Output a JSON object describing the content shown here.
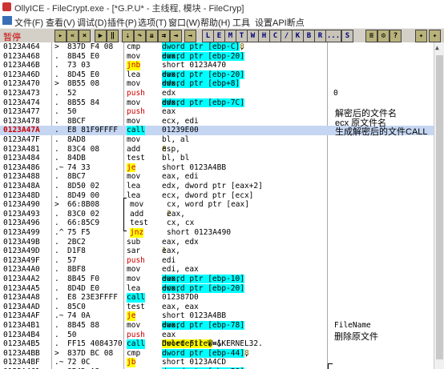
{
  "window": {
    "title": "OllyICE - FileCrypt.exe - [*G.P.U* - 主线程, 模块 - FileCryp]"
  },
  "menu": [
    "文件(F)",
    "查看(V)",
    "调试(D)",
    "插件(P)",
    "选项(T)",
    "窗口(W)",
    "帮助(H)",
    "工具",
    "设置API断点"
  ],
  "toolbar": {
    "status": "暂停",
    "buttons": [
      "L",
      "E",
      "M",
      "T",
      "W",
      "H",
      "C",
      "/",
      "K",
      "B",
      "R",
      "...",
      "S"
    ]
  },
  "rows": [
    {
      "addr": "0123A464",
      "flag": ">",
      "hex": "837D F4 08",
      "mn": "cmp",
      "ops": [
        {
          "t": "dword ptr [ebp-C]",
          "s": "hl"
        },
        {
          "t": ", "
        },
        {
          "t": "8",
          "s": "n"
        }
      ]
    },
    {
      "addr": "0123A468",
      "flag": ".",
      "hex": "8B45 E0",
      "mn": "mov",
      "ops": [
        {
          "t": "eax, "
        },
        {
          "t": "dword ptr [ebp-20]",
          "s": "hl"
        }
      ]
    },
    {
      "addr": "0123A46B",
      "flag": ".",
      "hex": "73 03",
      "mn": "jnb",
      "ms": "y",
      "ops": [
        {
          "t": "short 0123A470"
        }
      ]
    },
    {
      "addr": "0123A46D",
      "flag": ".",
      "hex": "8D45 E0",
      "mn": "lea",
      "ops": [
        {
          "t": "eax, "
        },
        {
          "t": "dword ptr [ebp-20]",
          "s": "hl"
        }
      ]
    },
    {
      "addr": "0123A470",
      "flag": ">",
      "hex": "8B55 08",
      "mn": "mov",
      "ops": [
        {
          "t": "edx, "
        },
        {
          "t": "dword ptr [ebp+8]",
          "s": "hl"
        }
      ]
    },
    {
      "addr": "0123A473",
      "flag": ".",
      "hex": "52",
      "mn": "push",
      "ms": "r",
      "ops": [
        {
          "t": "edx"
        }
      ],
      "cmt": "0"
    },
    {
      "addr": "0123A474",
      "flag": ".",
      "hex": "8B55 84",
      "mn": "mov",
      "ops": [
        {
          "t": "edx, "
        },
        {
          "t": "dword ptr [ebp-7C]",
          "s": "hl"
        }
      ]
    },
    {
      "addr": "0123A477",
      "flag": ".",
      "hex": "50",
      "mn": "push",
      "ms": "r",
      "ops": [
        {
          "t": "eax"
        }
      ]
    },
    {
      "addr": "0123A478",
      "flag": ".",
      "hex": "8BCF",
      "mn": "mov",
      "ops": [
        {
          "t": "ecx, edi"
        }
      ]
    },
    {
      "addr": "0123A47A",
      "flag": ".",
      "hex": "E8 81F9FFFF",
      "mn": "call",
      "ms": "c",
      "ops": [
        {
          "t": "01239E00"
        }
      ],
      "sel": true
    },
    {
      "addr": "0123A47F",
      "flag": ".",
      "hex": "8AD8",
      "mn": "mov",
      "ops": [
        {
          "t": "bl, al"
        }
      ]
    },
    {
      "addr": "0123A481",
      "flag": ".",
      "hex": "83C4 08",
      "mn": "add",
      "ops": [
        {
          "t": "esp, "
        },
        {
          "t": "8",
          "s": "n"
        }
      ]
    },
    {
      "addr": "0123A484",
      "flag": ".",
      "hex": "84DB",
      "mn": "test",
      "ops": [
        {
          "t": "bl, bl"
        }
      ]
    },
    {
      "addr": "0123A486",
      "flag": ".~",
      "hex": "74 33",
      "mn": "je",
      "ms": "y",
      "ops": [
        {
          "t": "short 0123A4BB"
        }
      ]
    },
    {
      "addr": "0123A488",
      "flag": ".",
      "hex": "8BC7",
      "mn": "mov",
      "ops": [
        {
          "t": "eax, edi"
        }
      ]
    },
    {
      "addr": "0123A48A",
      "flag": ".",
      "hex": "8D50 02",
      "mn": "lea",
      "ops": [
        {
          "t": "edx, dword ptr [eax+2]"
        }
      ]
    },
    {
      "addr": "0123A48D",
      "flag": ".",
      "hex": "8D49 00",
      "mn": "lea",
      "ops": [
        {
          "t": "ecx, dword ptr [ecx]"
        }
      ]
    },
    {
      "addr": "0123A490",
      "flag": ">",
      "hex": "66:8B08",
      "mn": "mov",
      "ops": [
        {
          "t": "cx, word ptr [eax]"
        }
      ],
      "ind": true
    },
    {
      "addr": "0123A493",
      "flag": ".",
      "hex": "83C0 02",
      "mn": "add",
      "ops": [
        {
          "t": "eax, "
        },
        {
          "t": "2",
          "s": "n"
        }
      ],
      "ind": true
    },
    {
      "addr": "0123A496",
      "flag": ".",
      "hex": "66:85C9",
      "mn": "test",
      "ops": [
        {
          "t": "cx, cx"
        }
      ],
      "ind": true
    },
    {
      "addr": "0123A499",
      "flag": ".^",
      "hex": "75 F5",
      "mn": "jnz",
      "ms": "y",
      "ops": [
        {
          "t": "short 0123A490"
        }
      ],
      "ind": true
    },
    {
      "addr": "0123A49B",
      "flag": ".",
      "hex": "2BC2",
      "mn": "sub",
      "ops": [
        {
          "t": "eax, edx"
        }
      ]
    },
    {
      "addr": "0123A49D",
      "flag": ".",
      "hex": "D1F8",
      "mn": "sar",
      "ops": [
        {
          "t": "eax, "
        },
        {
          "t": "1",
          "s": "n"
        }
      ]
    },
    {
      "addr": "0123A49F",
      "flag": ".",
      "hex": "57",
      "mn": "push",
      "ms": "r",
      "ops": [
        {
          "t": "edi"
        }
      ]
    },
    {
      "addr": "0123A4A0",
      "flag": ".",
      "hex": "8BF8",
      "mn": "mov",
      "ops": [
        {
          "t": "edi, eax"
        }
      ]
    },
    {
      "addr": "0123A4A2",
      "flag": ".",
      "hex": "8B45 F0",
      "mn": "mov",
      "ops": [
        {
          "t": "eax, "
        },
        {
          "t": "dword ptr [ebp-10]",
          "s": "hl"
        }
      ]
    },
    {
      "addr": "0123A4A5",
      "flag": ".",
      "hex": "8D4D E0",
      "mn": "lea",
      "ops": [
        {
          "t": "ecx, "
        },
        {
          "t": "dword ptr [ebp-20]",
          "s": "hl"
        }
      ]
    },
    {
      "addr": "0123A4A8",
      "flag": ".",
      "hex": "E8 23E3FFFF",
      "mn": "call",
      "ms": "c",
      "ops": [
        {
          "t": "012387D0",
          "s": "r"
        }
      ]
    },
    {
      "addr": "0123A4AD",
      "flag": ".",
      "hex": "85C0",
      "mn": "test",
      "ops": [
        {
          "t": "eax, eax"
        }
      ]
    },
    {
      "addr": "0123A4AF",
      "flag": ".~",
      "hex": "74 0A",
      "mn": "je",
      "ms": "y",
      "ops": [
        {
          "t": "short 0123A4BB"
        }
      ]
    },
    {
      "addr": "0123A4B1",
      "flag": ".",
      "hex": "8B45 88",
      "mn": "mov",
      "ops": [
        {
          "t": "eax, "
        },
        {
          "t": "dword ptr [ebp-78]",
          "s": "hl"
        }
      ]
    },
    {
      "addr": "0123A4B4",
      "flag": ".",
      "hex": "50",
      "mn": "push",
      "ms": "r",
      "ops": [
        {
          "t": "eax"
        }
      ]
    },
    {
      "addr": "0123A4B5",
      "flag": ".",
      "hex": "FF15 4084370",
      "mn": "call",
      "ms": "c",
      "ops": [
        {
          "t": "dword ptr [<&KERNEL32."
        },
        {
          "t": "DeleteFileW",
          "s": "hy"
        },
        {
          "t": ">]"
        }
      ]
    },
    {
      "addr": "0123A4BB",
      "flag": ">",
      "hex": "837D BC 08",
      "mn": "cmp",
      "ops": [
        {
          "t": "dword ptr [ebp-44]",
          "s": "hl"
        },
        {
          "t": ", "
        },
        {
          "t": "8",
          "s": "n"
        }
      ]
    },
    {
      "addr": "0123A4BF",
      "flag": ".~",
      "hex": "72 0C",
      "mn": "jb",
      "ms": "y",
      "ops": [
        {
          "t": "short 0123A4CD"
        }
      ]
    },
    {
      "addr": "0123A4C1",
      "flag": ".",
      "hex": "8B4D A8",
      "mn": "mov",
      "ops": [
        {
          "t": "ecx, "
        },
        {
          "t": "dword ptr [ebp-58]",
          "s": "hl"
        }
      ]
    }
  ],
  "notes": {
    "decrypted_name": "解密后的文件名",
    "ecx_note": "ecx 原文件名",
    "call_note": "生成解密后的文件CALL",
    "filename_label": "FileName",
    "delete_note": "删除原文件"
  }
}
